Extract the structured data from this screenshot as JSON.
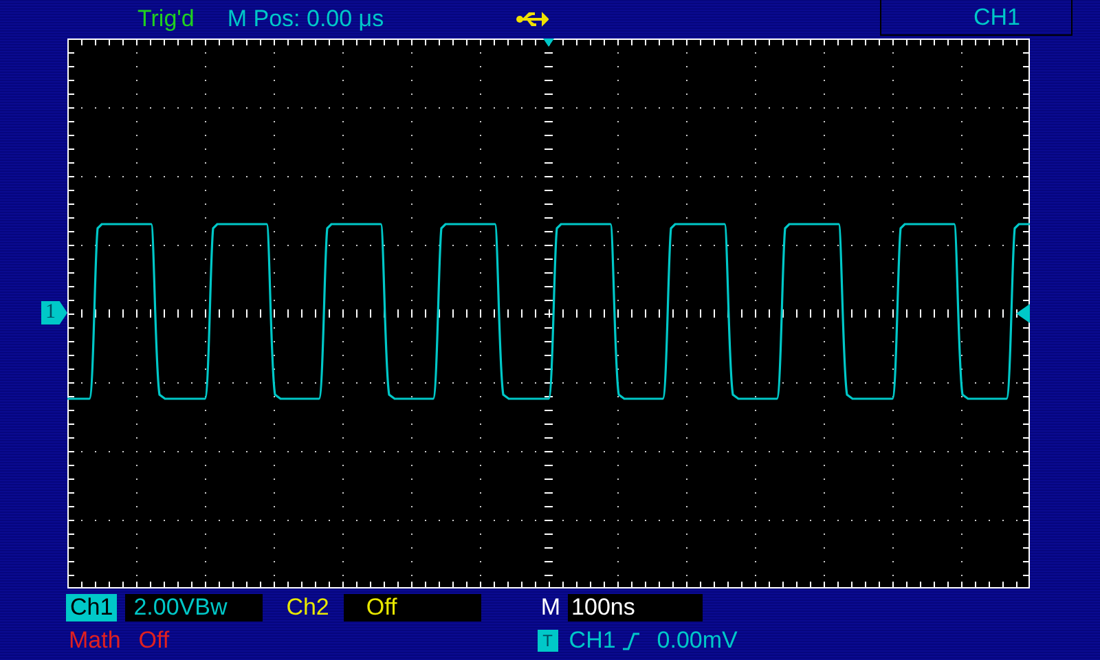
{
  "status": {
    "trigger_state": "Trig'd",
    "main_position": "M Pos: 0.00 μs"
  },
  "menu": {
    "title": "CH1"
  },
  "marker": {
    "label": "1"
  },
  "channels": [
    {
      "label": "Ch1",
      "setting": "2.00VBw",
      "enabled": true,
      "color": "#00c8c8"
    },
    {
      "label": "Ch2",
      "setting": "Off",
      "enabled": false,
      "color": "#e8e800"
    }
  ],
  "math": {
    "label": "Math",
    "setting": "Off"
  },
  "timebase": {
    "label": "M",
    "setting": "100ns"
  },
  "trigger": {
    "badge": "T",
    "source": "CH1",
    "threshold": "0.00mV"
  }
}
